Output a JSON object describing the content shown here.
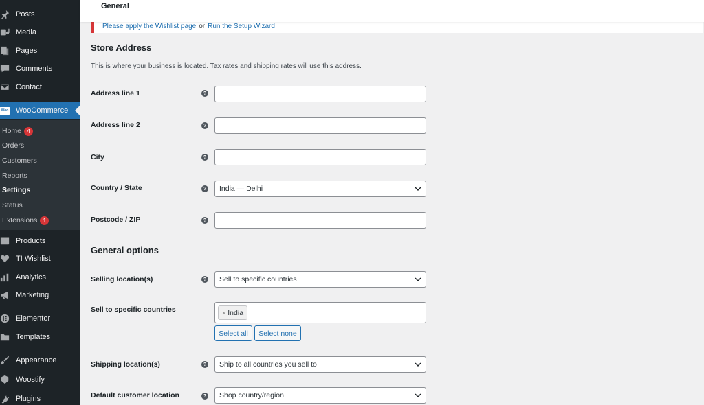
{
  "sidebar": {
    "items": [
      {
        "label": "Posts",
        "icon": "pin-icon"
      },
      {
        "label": "Media",
        "icon": "media-icon"
      },
      {
        "label": "Pages",
        "icon": "pages-icon"
      },
      {
        "label": "Comments",
        "icon": "comments-icon"
      },
      {
        "label": "Contact",
        "icon": "mail-icon"
      },
      {
        "label": "WooCommerce",
        "icon": "woo-icon"
      },
      {
        "label": "Products",
        "icon": "products-icon"
      },
      {
        "label": "TI Wishlist",
        "icon": "heart-icon"
      },
      {
        "label": "Analytics",
        "icon": "analytics-icon"
      },
      {
        "label": "Marketing",
        "icon": "megaphone-icon"
      },
      {
        "label": "Elementor",
        "icon": "elementor-icon"
      },
      {
        "label": "Templates",
        "icon": "folder-icon"
      },
      {
        "label": "Appearance",
        "icon": "brush-icon"
      },
      {
        "label": "Woostify",
        "icon": "woostify-icon"
      },
      {
        "label": "Plugins",
        "icon": "plug-icon"
      }
    ],
    "woo_logo_text": "Woo",
    "submenu": [
      {
        "label": "Home",
        "badge": "4"
      },
      {
        "label": "Orders"
      },
      {
        "label": "Customers"
      },
      {
        "label": "Reports"
      },
      {
        "label": "Settings"
      },
      {
        "label": "Status"
      },
      {
        "label": "Extensions",
        "badge": "1"
      }
    ]
  },
  "topbar": {
    "tab": "General"
  },
  "notice": {
    "text_a": "Please apply the Wishlist page",
    "text_or": "or",
    "text_b": "Run the Setup Wizard"
  },
  "store_address": {
    "heading": "Store Address",
    "description": "This is where your business is located. Tax rates and shipping rates will use this address.",
    "fields": {
      "address1": {
        "label": "Address line 1",
        "value": ""
      },
      "address2": {
        "label": "Address line 2",
        "value": ""
      },
      "city": {
        "label": "City",
        "value": ""
      },
      "country": {
        "label": "Country / State",
        "value": "India — Delhi"
      },
      "postcode": {
        "label": "Postcode / ZIP",
        "value": ""
      }
    }
  },
  "general_options": {
    "heading": "General options",
    "selling_location": {
      "label": "Selling location(s)",
      "value": "Sell to specific countries"
    },
    "specific_countries": {
      "label": "Sell to specific countries",
      "chips": [
        "India"
      ],
      "chip_remove": "×"
    },
    "select_all": "Select all",
    "select_none": "Select none",
    "shipping_location": {
      "label": "Shipping location(s)",
      "value": "Ship to all countries you sell to"
    },
    "default_customer_location": {
      "label": "Default customer location",
      "value": "Shop country/region"
    }
  },
  "help_glyph": "?",
  "colors": {
    "sidebar_bg": "#1d2327",
    "submenu_bg": "#2c3338",
    "accent": "#2271b1",
    "badge": "#d63638",
    "notice_border": "#d63638"
  }
}
